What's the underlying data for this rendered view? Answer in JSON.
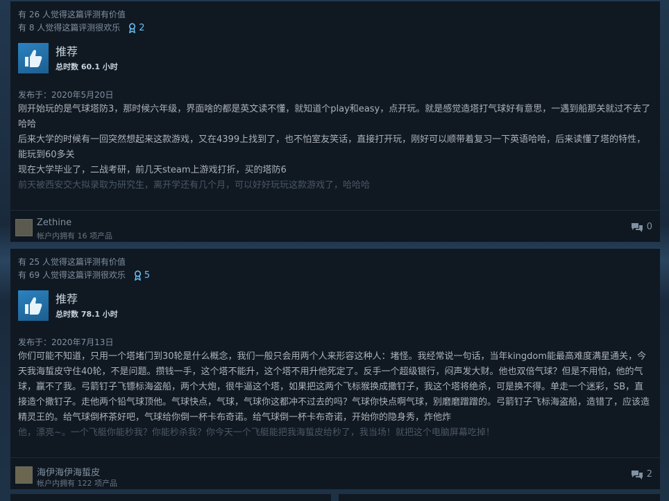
{
  "reviews": [
    {
      "helpful": "有 26 人觉得这篇评测有价值",
      "funny": "有 8 人觉得这篇评测很欢乐",
      "awards": "2",
      "recommendation": "推荐",
      "hours": "总时数 60.1 小时",
      "posted": "发布于：2020年5月20日",
      "lines": [
        "刚开始玩的是气球塔防3，那时候六年级，界面啥的都是英文读不懂，就知道个play和easy，点开玩。就是感觉造塔打气球好有意思，一遇到船那关就过不去了哈哈",
        "后来大学的时候有一回突然想起来这款游戏，又在4399上找到了，也不怕室友笑话，直接打开玩，刚好可以顺带着复习一下英语哈哈，后来读懂了塔的特性，能玩到60多关",
        "现在大学毕业了，二战考研，前几天steam上游戏打折，买的塔防6"
      ],
      "fade_line": "前天被西安交大拟录取为研究生，离开学还有几个月，可以好好玩玩这款游戏了，哈哈哈",
      "author": "Zethine",
      "products": "帐户内拥有 16 项产品",
      "comments": "0"
    },
    {
      "helpful": "有 25 人觉得这篇评测有价值",
      "funny": "有 69 人觉得这篇评测很欢乐",
      "awards": "5",
      "recommendation": "推荐",
      "hours": "总时数 78.1 小时",
      "posted": "发布于：2020年7月13日",
      "lines": [
        "你们可能不知道，只用一个塔堵门到30轮是什么概念，我们一般只会用两个人来形容这种人：堵怪。我经常说一句话，当年kingdom能最高难度满星通关，今天我海蜇皮守住40轮，不是问题。攒钱一手，这个塔不能升，这个塔不用升他死定了。反手一个超级银行，闷声发大财。他也双倍气球？但是不用怕，他的气球，赢不了我。弓箭钉子飞镖标海盗船，两个大炮，很牛逼这个塔，如果把这两个飞标猴换成撒钉子，我这个塔将绝杀，可是换不得。单走一个迷彩，SB，直接造个撒钉子。走他两个铅气球顶他。气球快点，气球，气球你这都冲不过去的吗？气球你快点啊气球，别磨磨蹭蹭的。弓箭钉子飞标海盗船，造错了，应该造精灵王的。给气球倒杯茶好吧，气球给你倒一杯卡布奇诺。给气球倒一杯卡布奇诺，开始你的隐身秀，炸他炸"
      ],
      "fade_line": "他，漂亮~。一个飞艇你能秒我？你能秒杀我？你今天一个飞艇能把我海蜇皮给秒了，我当场！就把这个电脑屏幕吃掉！",
      "author": "海伊海伊海蜇皮",
      "products": "帐户内拥有 122 项产品",
      "comments": "2"
    }
  ]
}
